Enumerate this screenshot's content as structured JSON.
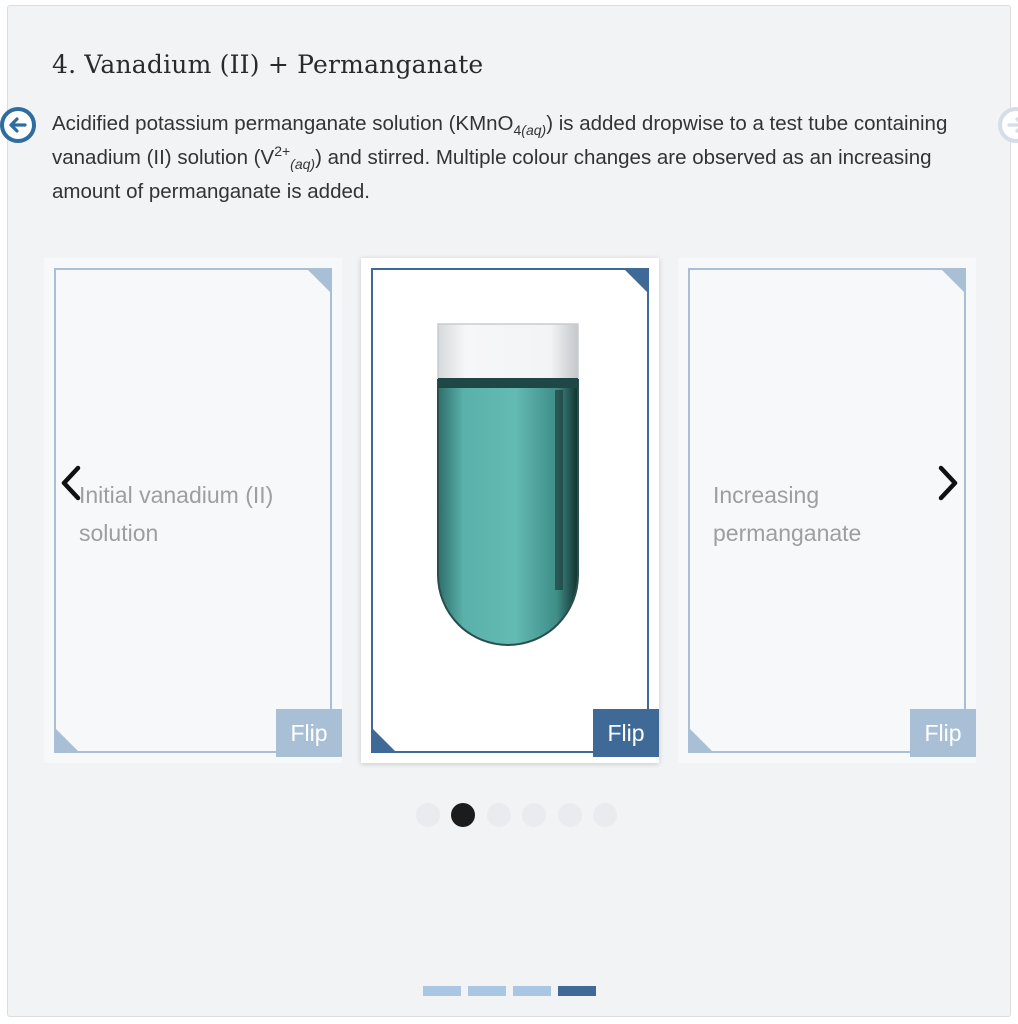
{
  "title": "4. Vanadium (II) + Permanganate",
  "description": {
    "p1": "Acidified potassium permanganate solution (KMnO",
    "p1_sub_num": "4",
    "p1_sub_state": "(aq)",
    "p2": ") is added dropwise to a test tube containing vanadium (II) solution (V",
    "p2_sup": "2+",
    "p2_sub_state": "(aq)",
    "p3": ") and stirred. Multiple colour changes are observed as an increasing amount of permanganate is added."
  },
  "nav": {
    "prev_icon": "arrow-left-circle-icon",
    "next_icon": "arrow-right-circle-icon"
  },
  "cards": [
    {
      "label": "Initial vanadium (II) solution",
      "flip_label": "Flip",
      "active": false
    },
    {
      "label": "",
      "image": "test-tube-teal-solution",
      "flip_label": "Flip",
      "active": true
    },
    {
      "label": "Increasing permanganate",
      "flip_label": "Flip",
      "active": false
    }
  ],
  "carousel": {
    "prev_icon": "chevron-left-icon",
    "next_icon": "chevron-right-icon",
    "dot_count": 6,
    "active_dot": 1
  },
  "progress": {
    "segment_count": 4,
    "active_segment": 3
  },
  "colors": {
    "accent": "#3f6a98",
    "accent_light": "#a9bfd6",
    "solution": "#5fb3ad"
  }
}
